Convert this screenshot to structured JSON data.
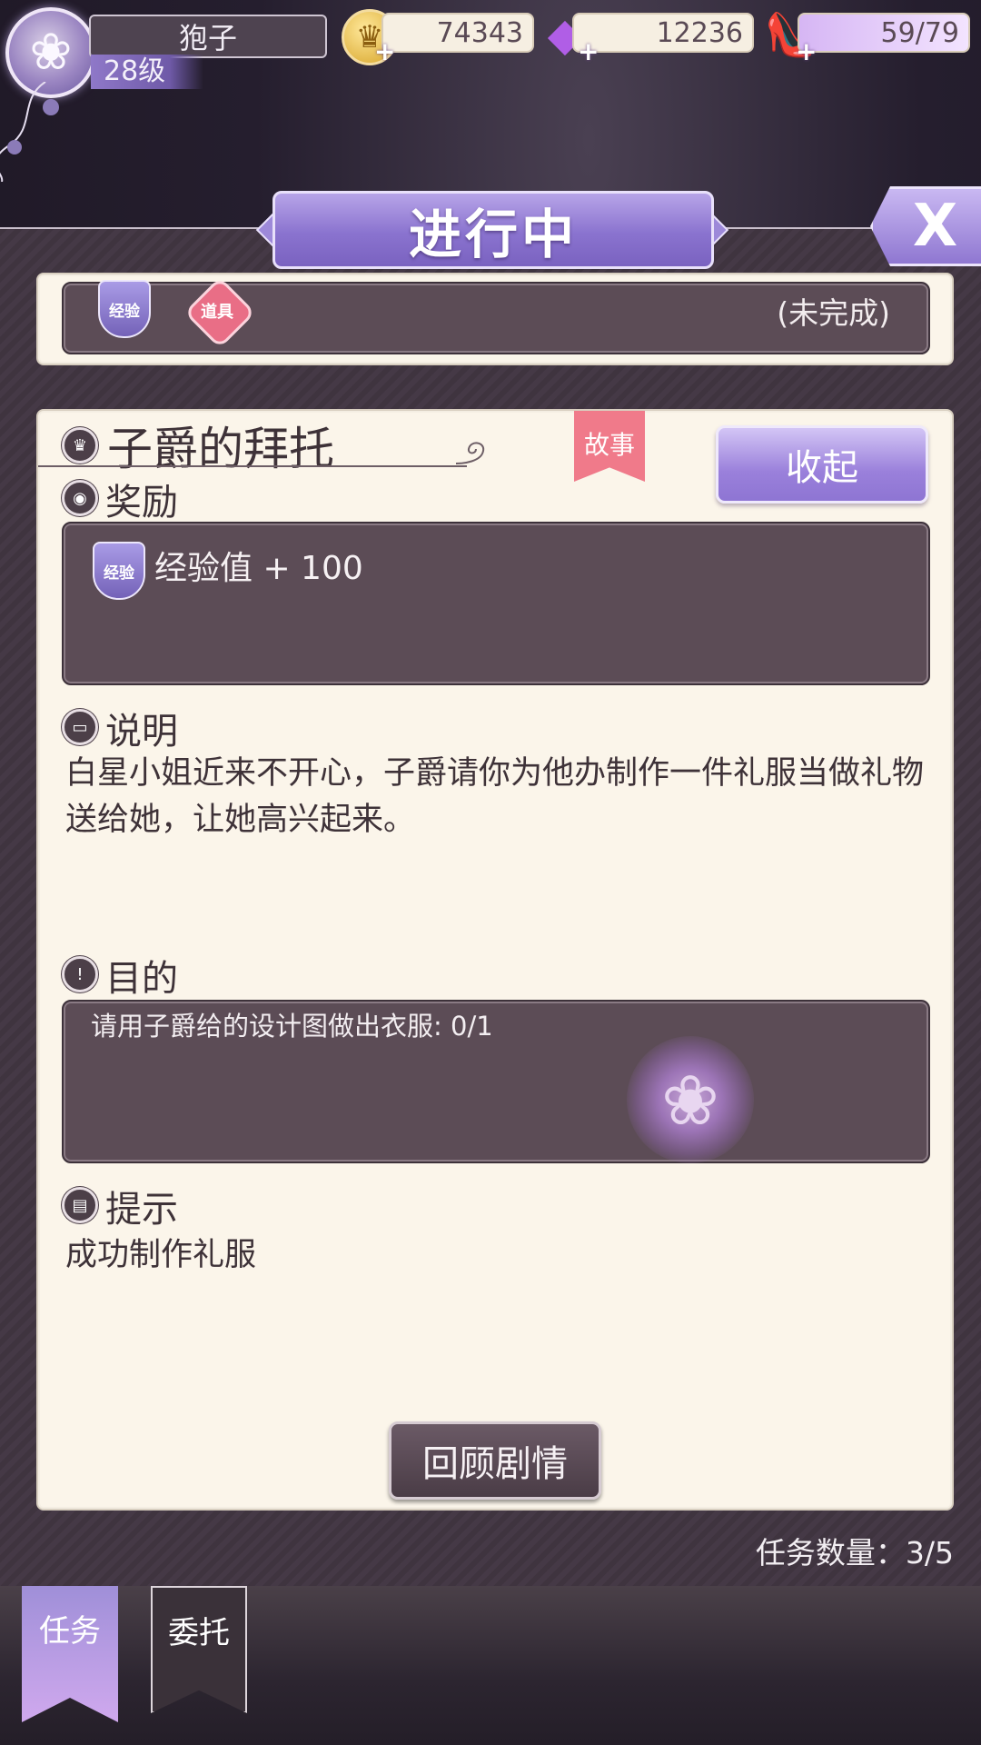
{
  "player": {
    "name": "狍子",
    "level": "28级"
  },
  "resources": {
    "gold": "74343",
    "gems": "12236",
    "energy": "59/79"
  },
  "icons": {
    "avatar": "rose-avatar-icon",
    "gold": "crown-coin-icon",
    "gems": "gem-icon",
    "energy": "glass-slipper-icon",
    "close": "close-icon"
  },
  "header": {
    "title": "进行中",
    "close_label": "X"
  },
  "previous_quest": {
    "exp_badge": "经验",
    "item_badge": "道具",
    "status": "(未完成)"
  },
  "quest": {
    "title": "子爵的拜托",
    "tag": "故事",
    "collapse_label": "收起",
    "reward_heading": "奖励",
    "reward_badge": "经验",
    "reward_text": "经验值 + 100",
    "description_heading": "说明",
    "description": "白星小姐近来不开心，子爵请你为他办制作一件礼服当做礼物送给她，让她高兴起来。",
    "goal_heading": "目的",
    "goal_text": "请用子爵给的设计图做出衣服: 0/1",
    "hint_heading": "提示",
    "hint_text": "成功制作礼服",
    "review_label": "回顾剧情"
  },
  "quest_count": "任务数量：3/5",
  "tabs": [
    {
      "label": "任务",
      "active": true
    },
    {
      "label": "委托",
      "active": false
    }
  ],
  "colors": {
    "accent_purple": "#8a73cf",
    "panel_cream": "#fbf5ea",
    "dark_box": "#5c4c56",
    "story_tag": "#f07a8a"
  }
}
